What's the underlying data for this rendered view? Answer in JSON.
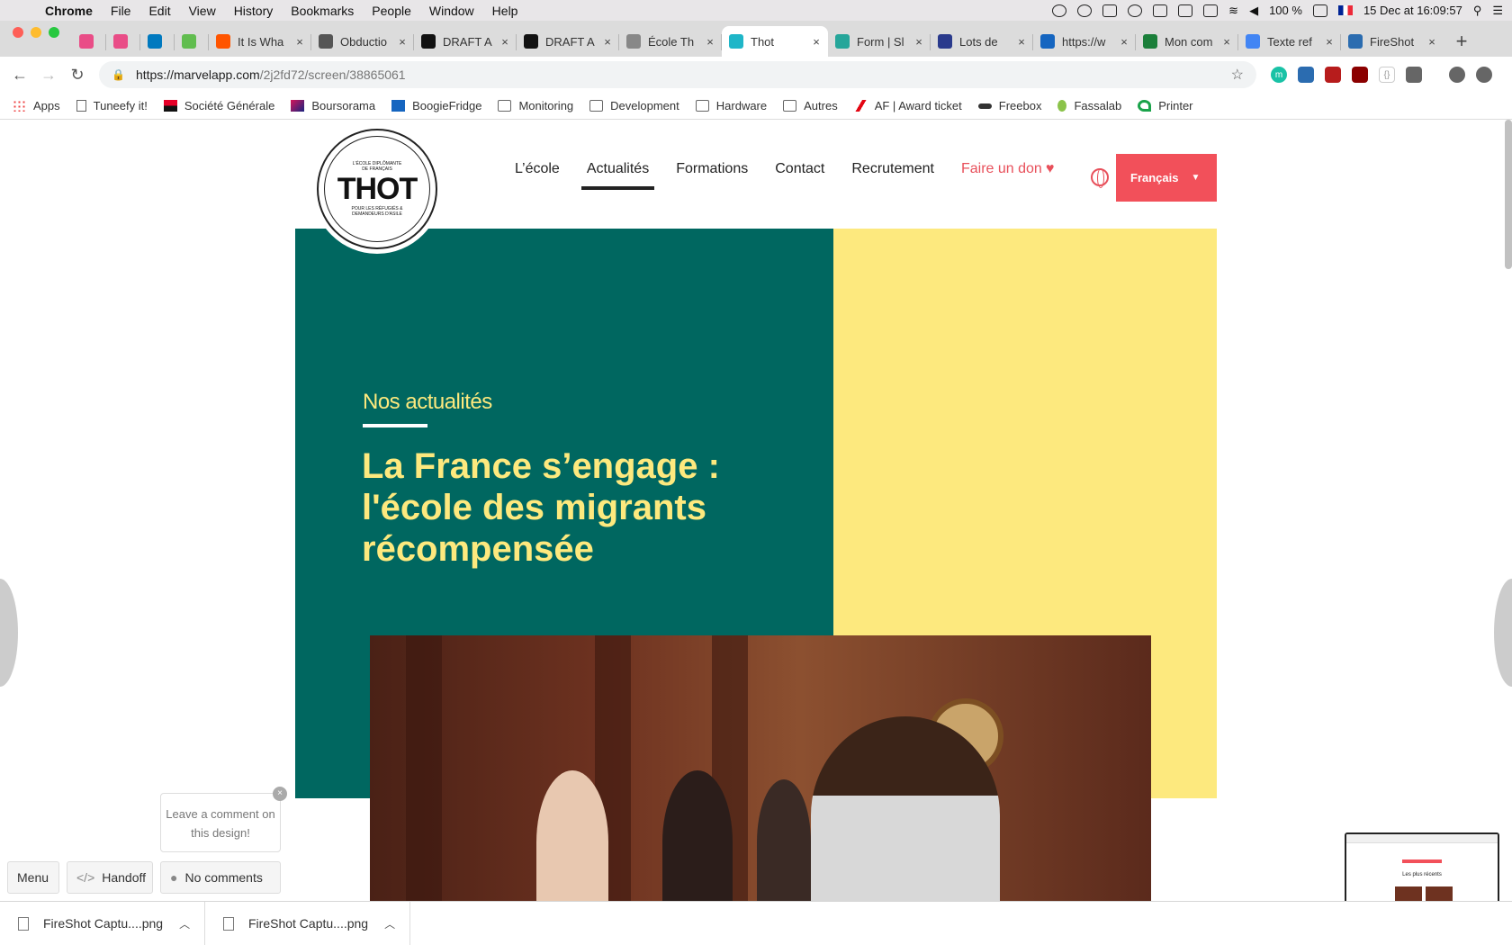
{
  "menubar": {
    "app": "Chrome",
    "items": [
      "File",
      "Edit",
      "View",
      "History",
      "Bookmarks",
      "People",
      "Window",
      "Help"
    ],
    "battery": "100 %",
    "datetime": "15 Dec at  16:09:57"
  },
  "tabs": [
    {
      "title": "",
      "icon": "k-icon",
      "color": "#e94d87"
    },
    {
      "title": "",
      "icon": "k-icon",
      "color": "#e94d87"
    },
    {
      "title": "",
      "icon": "trello-icon",
      "color": "#0079bf"
    },
    {
      "title": "",
      "icon": "trello-icon",
      "color": "#61bd4f"
    },
    {
      "title": "It Is Wha",
      "icon": "soundcloud-icon",
      "color": "#ff5500"
    },
    {
      "title": "Obductio",
      "icon": "obduction-icon",
      "color": "#555555"
    },
    {
      "title": "DRAFT A",
      "icon": "r-icon",
      "color": "#111111"
    },
    {
      "title": "DRAFT A",
      "icon": "r-icon",
      "color": "#111111"
    },
    {
      "title": "École Th",
      "icon": "doc-icon",
      "color": "#888888"
    },
    {
      "title": "Thot",
      "icon": "marvel-icon",
      "color": "#1fb6c8",
      "active": true
    },
    {
      "title": "Form | Sl",
      "icon": "s-icon",
      "color": "#26a69a"
    },
    {
      "title": "Lots de",
      "icon": "lots-icon",
      "color": "#2a3a8c"
    },
    {
      "title": "https://w",
      "icon": "m-icon",
      "color": "#1565c0"
    },
    {
      "title": "Mon com",
      "icon": "k-icon",
      "color": "#1b7f3a"
    },
    {
      "title": "Texte ref",
      "icon": "gdocs-icon",
      "color": "#4285f4"
    },
    {
      "title": "FireShot",
      "icon": "fireshot-icon",
      "color": "#2b6cb0"
    }
  ],
  "address": {
    "host": "https://marvelapp.com",
    "path": "/2j2fd72/screen/38865061"
  },
  "bookmarks": [
    "Apps",
    "Tuneefy it!",
    "Société Générale",
    "Boursorama",
    "BoogieFridge",
    "Monitoring",
    "Development",
    "Hardware",
    "Autres",
    "AF | Award ticket",
    "Freebox",
    "Fassalab",
    "Printer"
  ],
  "site": {
    "logo_text": "THOT",
    "logo_top": "L'ÉCOLE DIPLÔMANTE DE FRANÇAIS",
    "logo_bottom": "POUR LES RÉFUGIÉS & DEMANDEURS D'ASILE",
    "nav": [
      "L’école",
      "Actualités",
      "Formations",
      "Contact",
      "Recrutement"
    ],
    "nav_active": "Actualités",
    "donate": "Faire un don",
    "language": "Français",
    "kicker": "Nos actualités",
    "headline": "La France s’engage : l'école des migrants récompensée",
    "colors": {
      "green": "#006760",
      "yellow": "#fde97e",
      "red": "#f2505a"
    }
  },
  "marvel": {
    "comment_tip": "Leave a comment on this design!",
    "menu": "Menu",
    "handoff": "Handoff",
    "comments": "No comments",
    "thumb_title": "Les plus récents"
  },
  "downloads": [
    "FireShot Captu....png",
    "FireShot Captu....png"
  ]
}
